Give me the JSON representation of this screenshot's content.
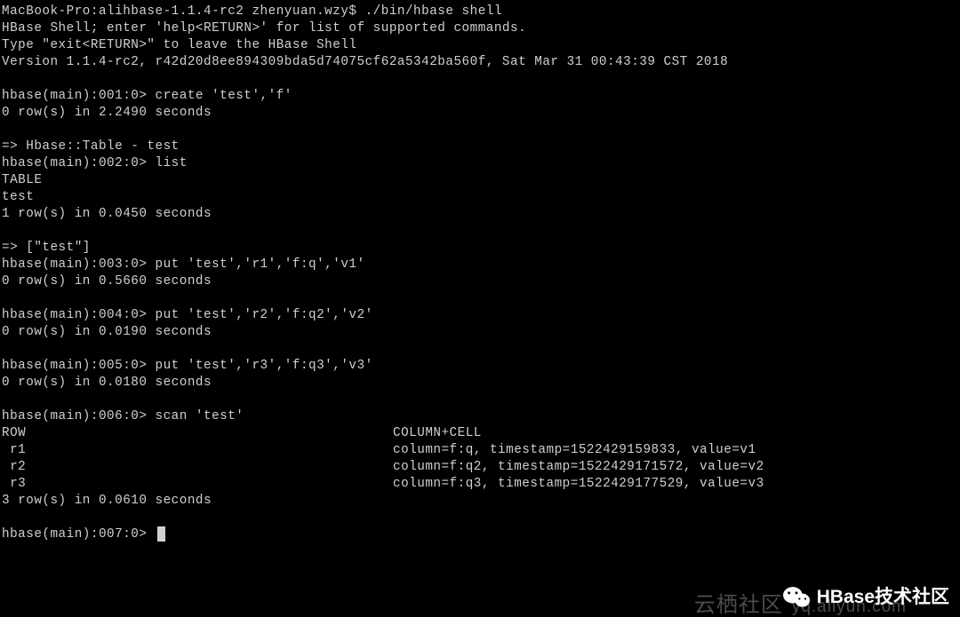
{
  "terminal": {
    "header": {
      "line1": "MacBook-Pro:alihbase-1.1.4-rc2 zhenyuan.wzy$ ./bin/hbase shell",
      "line2": "HBase Shell; enter 'help<RETURN>' for list of supported commands.",
      "line3": "Type \"exit<RETURN>\" to leave the HBase Shell",
      "line4": "Version 1.1.4-rc2, r42d20d8ee894309bda5d74075cf62a5342ba560f, Sat Mar 31 00:43:39 CST 2018"
    },
    "blank": "",
    "cmd1": {
      "prompt": "hbase(main):001:0> ",
      "command": "create 'test','f'",
      "result": "0 row(s) in 2.2490 seconds",
      "result2": "=> Hbase::Table - test"
    },
    "cmd2": {
      "prompt": "hbase(main):002:0> ",
      "command": "list",
      "out1": "TABLE",
      "out2": "test",
      "out3": "1 row(s) in 0.0450 seconds",
      "out4": "=> [\"test\"]"
    },
    "cmd3": {
      "prompt": "hbase(main):003:0> ",
      "command": "put 'test','r1','f:q','v1'",
      "result": "0 row(s) in 0.5660 seconds"
    },
    "cmd4": {
      "prompt": "hbase(main):004:0> ",
      "command": "put 'test','r2','f:q2','v2'",
      "result": "0 row(s) in 0.0190 seconds"
    },
    "cmd5": {
      "prompt": "hbase(main):005:0> ",
      "command": "put 'test','r3','f:q3','v3'",
      "result": "0 row(s) in 0.0180 seconds"
    },
    "cmd6": {
      "prompt": "hbase(main):006:0> ",
      "command": "scan 'test'",
      "header_col1": "ROW",
      "header_col2": "COLUMN+CELL",
      "rows": [
        {
          "c1": " r1",
          "c2": "column=f:q, timestamp=1522429159833, value=v1"
        },
        {
          "c1": " r2",
          "c2": "column=f:q2, timestamp=1522429171572, value=v2"
        },
        {
          "c1": " r3",
          "c2": "column=f:q3, timestamp=1522429177529, value=v3"
        }
      ],
      "footer": "3 row(s) in 0.0610 seconds"
    },
    "cmd7": {
      "prompt": "hbase(main):007:0> "
    }
  },
  "watermark": {
    "hbase_label": "HBase技术社区",
    "yunqi_cn": "云栖社区",
    "yunqi_en": "yq.aliyun.com"
  }
}
